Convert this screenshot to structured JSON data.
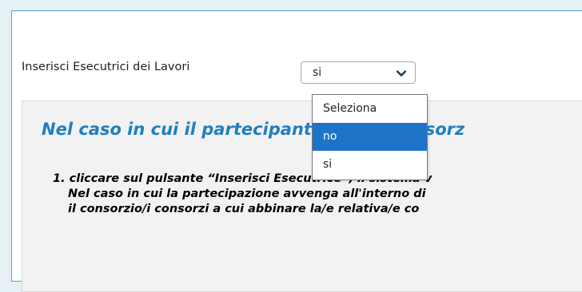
{
  "form": {
    "label": "Inserisci Esecutrici dei Lavori",
    "select": {
      "selected_value": "si",
      "options": [
        "Seleziona",
        "no",
        "si"
      ],
      "highlighted_option": "no"
    }
  },
  "info": {
    "title": "Nel caso in cui il partecipante sia un consorz",
    "lines": [
      "1. cliccare sul pulsante “Inserisci Esecutrice”, il sistema v",
      "Nel caso in cui la partecipazione avvenga all'interno di",
      "il consorzio/i consorzi a cui abbinare la/e relativa/e co"
    ]
  },
  "colors": {
    "accent": "#1f7fbf",
    "highlight": "#1e74c7",
    "card_border": "#4aa3d8"
  },
  "icons": {
    "select_arrow": "chevron-down-icon"
  }
}
